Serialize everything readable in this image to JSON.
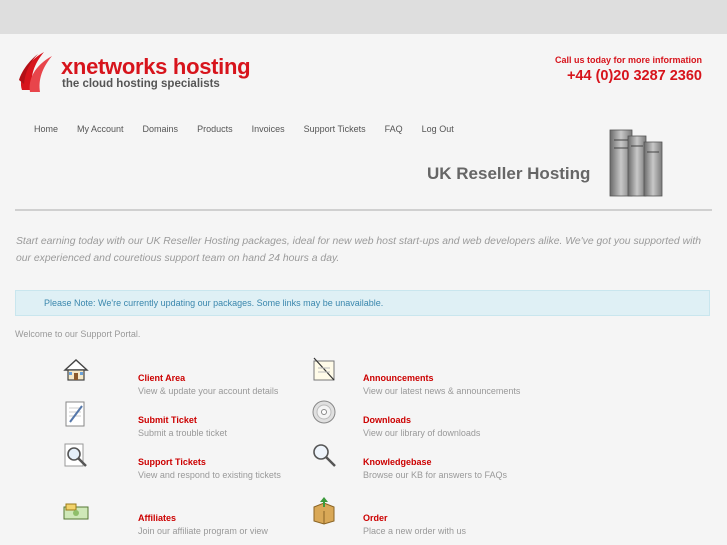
{
  "header": {
    "logo_name": "xnetworks hosting",
    "logo_tagline": "the cloud hosting specialists",
    "call_text": "Call us today for more information",
    "phone": "+44 (0)20 3287 2360"
  },
  "nav": [
    {
      "label": "Home"
    },
    {
      "label": "My Account"
    },
    {
      "label": "Domains"
    },
    {
      "label": "Products"
    },
    {
      "label": "Invoices"
    },
    {
      "label": "Support Tickets"
    },
    {
      "label": "FAQ"
    },
    {
      "label": "Log Out"
    }
  ],
  "page_title": "UK Reseller Hosting",
  "intro": "Start earning today with our UK Reseller Hosting packages, ideal for new web host start-ups and web developers alike. We've got you supported with our experienced and couretious support team on hand 24 hours a day.",
  "notice": "Please Note: We're currently updating our packages. Some links may be unavailable.",
  "welcome": "Welcome to our Support Portal.",
  "portal_items": [
    {
      "icon": "house-icon",
      "title": "Client Area",
      "desc": "View & update your account details"
    },
    {
      "icon": "announcement-icon",
      "title": "Announcements",
      "desc": "View our latest news & announcements"
    },
    {
      "icon": "pencil-document-icon",
      "title": "Submit Ticket",
      "desc": "Submit a trouble ticket"
    },
    {
      "icon": "disc-icon",
      "title": "Downloads",
      "desc": "View our library of downloads"
    },
    {
      "icon": "magnifier-document-icon",
      "title": "Support Tickets",
      "desc": "View and respond to existing tickets"
    },
    {
      "icon": "magnifier-icon",
      "title": "Knowledgebase",
      "desc": "Browse our KB for answers to FAQs"
    },
    {
      "icon": "money-icon",
      "title": "Affiliates",
      "desc": "Join our affiliate program or view"
    },
    {
      "icon": "package-icon",
      "title": "Order",
      "desc": "Place a new order with us"
    }
  ],
  "colors": {
    "brand": "#d7141c",
    "link": "#cc0000",
    "notice_text": "#3a87ad",
    "notice_bg": "#dff0f5"
  }
}
